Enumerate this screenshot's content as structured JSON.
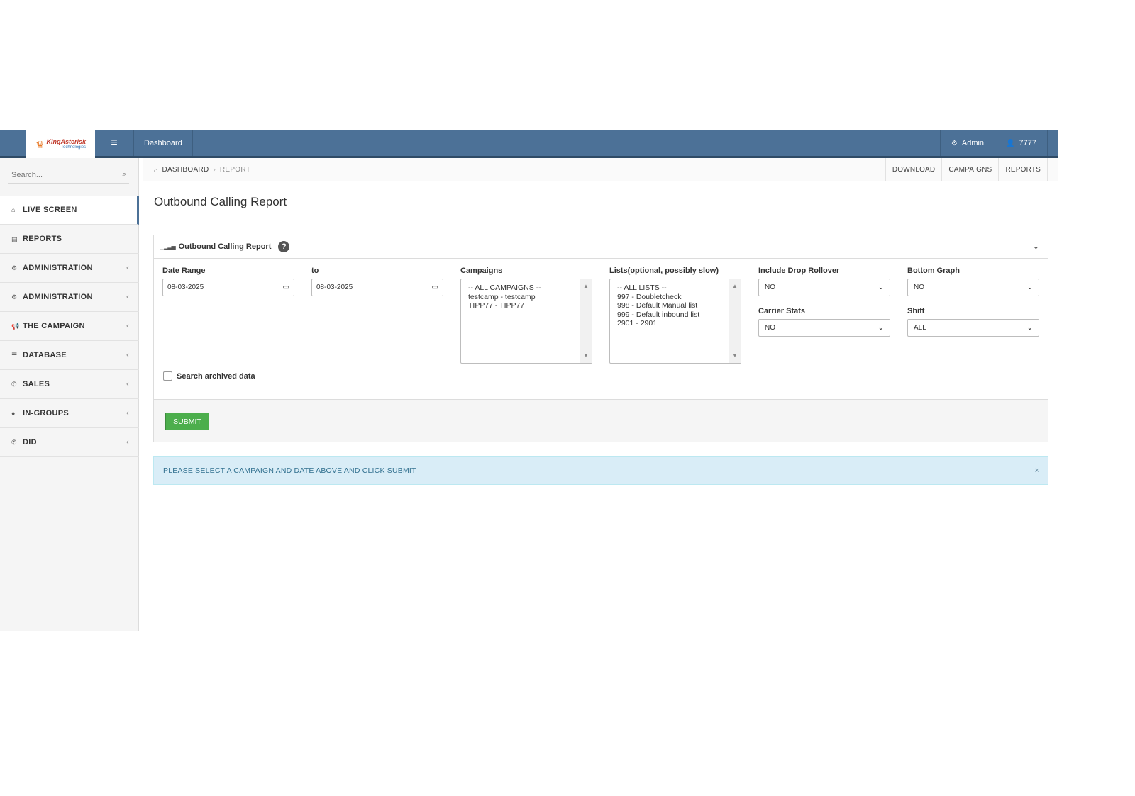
{
  "header": {
    "logo_text": "KingAsterisk",
    "logo_sub": "Technologies",
    "nav_dashboard": "Dashboard",
    "admin_label": "Admin",
    "user_label": "7777"
  },
  "sidebar": {
    "search_placeholder": "Search...",
    "items": [
      {
        "label": "LIVE SCREEN"
      },
      {
        "label": "REPORTS"
      },
      {
        "label": "ADMINISTRATION"
      },
      {
        "label": "ADMINISTRATION"
      },
      {
        "label": "THE CAMPAIGN"
      },
      {
        "label": "DATABASE"
      },
      {
        "label": "SALES"
      },
      {
        "label": "IN-GROUPS"
      },
      {
        "label": "DID"
      }
    ]
  },
  "breadcrumb": {
    "home": "DASHBOARD",
    "current": "REPORT"
  },
  "quick_links": [
    "DOWNLOAD",
    "CAMPAIGNS",
    "REPORTS"
  ],
  "page_title": "Outbound Calling Report",
  "panel": {
    "title": "Outbound Calling Report",
    "date_range_label": "Date Range",
    "to_label": "to",
    "date_from": "08-03-2025",
    "date_to": "08-03-2025",
    "campaigns_label": "Campaigns",
    "campaigns": [
      "-- ALL CAMPAIGNS --",
      "testcamp - testcamp",
      "TIPP77 - TIPP77"
    ],
    "lists_label": "Lists(optional, possibly slow)",
    "lists": [
      "-- ALL LISTS --",
      "997 - Doubletcheck",
      "998 - Default Manual list",
      "999 - Default inbound list",
      "2901 - 2901"
    ],
    "drop_rollover_label": "Include Drop Rollover",
    "drop_rollover_value": "NO",
    "bottom_graph_label": "Bottom Graph",
    "bottom_graph_value": "NO",
    "carrier_stats_label": "Carrier Stats",
    "carrier_stats_value": "NO",
    "shift_label": "Shift",
    "shift_value": "ALL",
    "archived_label": "Search archived data",
    "submit_label": "SUBMIT"
  },
  "alert": {
    "message": "PLEASE SELECT A CAMPAIGN AND DATE ABOVE AND CLICK SUBMIT",
    "close": "×"
  }
}
